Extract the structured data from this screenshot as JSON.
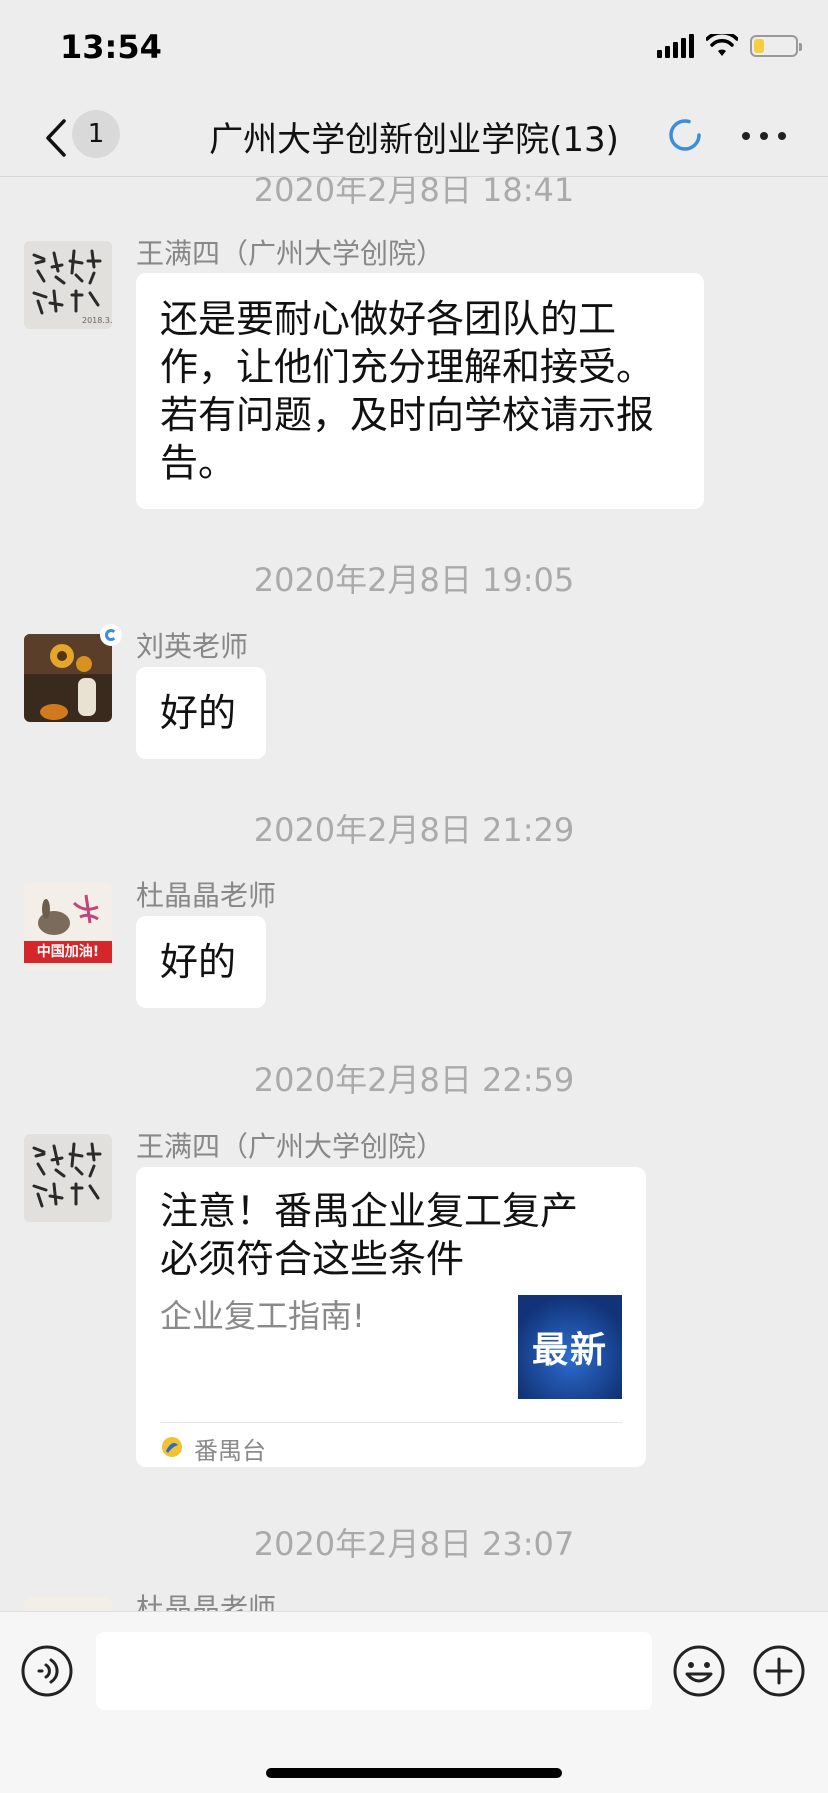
{
  "status_bar": {
    "time": "13:54",
    "battery_level": 0.25
  },
  "nav": {
    "unread_count": "1",
    "title": "广州大学创新创业学院(13)"
  },
  "messages": {
    "ts0": "2020年2月8日 18:41",
    "m1": {
      "sender": "王满四（广州大学创院）",
      "text": "还是要耐心做好各团队的工作，让他们充分理解和接受。若有问题，及时向学校请示报告。"
    },
    "ts1": "2020年2月8日 19:05",
    "m2": {
      "sender": "刘英老师",
      "text": "好的"
    },
    "ts2": "2020年2月8日 21:29",
    "m3": {
      "sender": "杜晶晶老师",
      "text": "好的",
      "avatar_caption": "中国加油!"
    },
    "ts3": "2020年2月8日 22:59",
    "m4": {
      "sender": "王满四（广州大学创院）",
      "card_title": "注意！番禺企业复工复产必须符合这些条件",
      "card_desc": "企业复工指南!",
      "card_thumb_text": "最新",
      "card_source": "番禺台"
    },
    "ts4": "2020年2月8日 23:07",
    "m5": {
      "sender": "杜晶晶老师"
    }
  },
  "input": {
    "value": ""
  },
  "colors": {
    "background": "#ededed",
    "bubble": "#ffffff",
    "accent_blue": "#3b8de0",
    "battery": "#f5cf3d"
  }
}
